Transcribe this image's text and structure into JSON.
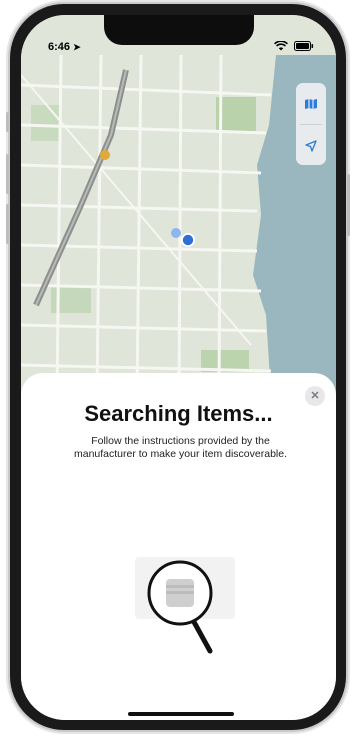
{
  "status_bar": {
    "time": "6:46",
    "location_arrow": "location-arrow-icon",
    "wifi": "wifi-icon",
    "battery": "battery-icon"
  },
  "map_controls": {
    "map_mode_icon": "map-icon",
    "locate_icon": "location-arrow-icon"
  },
  "sheet": {
    "title": "Searching Items...",
    "description": "Follow the instructions provided by the manufacturer to make your item discoverable.",
    "close_icon": "close-icon",
    "illustration": "magnifying-glass-icon"
  },
  "colors": {
    "accent": "#2f7bd9",
    "map_water": "#9ab7bf",
    "map_land": "#dfe5d9",
    "user_dot": "#2d6fd6"
  }
}
